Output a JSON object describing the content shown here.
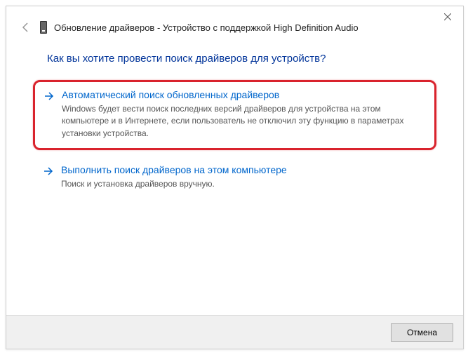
{
  "window": {
    "title": "Обновление драйверов - Устройство с поддержкой High Definition Audio"
  },
  "question": "Как вы хотите провести поиск драйверов для устройств?",
  "options": [
    {
      "title": "Автоматический поиск обновленных драйверов",
      "desc": "Windows будет вести поиск последних версий драйверов для устройства на этом компьютере и в Интернете, если пользователь не отключил эту функцию в параметрах установки устройства."
    },
    {
      "title": "Выполнить поиск драйверов на этом компьютере",
      "desc": "Поиск и установка драйверов вручную."
    }
  ],
  "footer": {
    "cancel": "Отмена"
  }
}
